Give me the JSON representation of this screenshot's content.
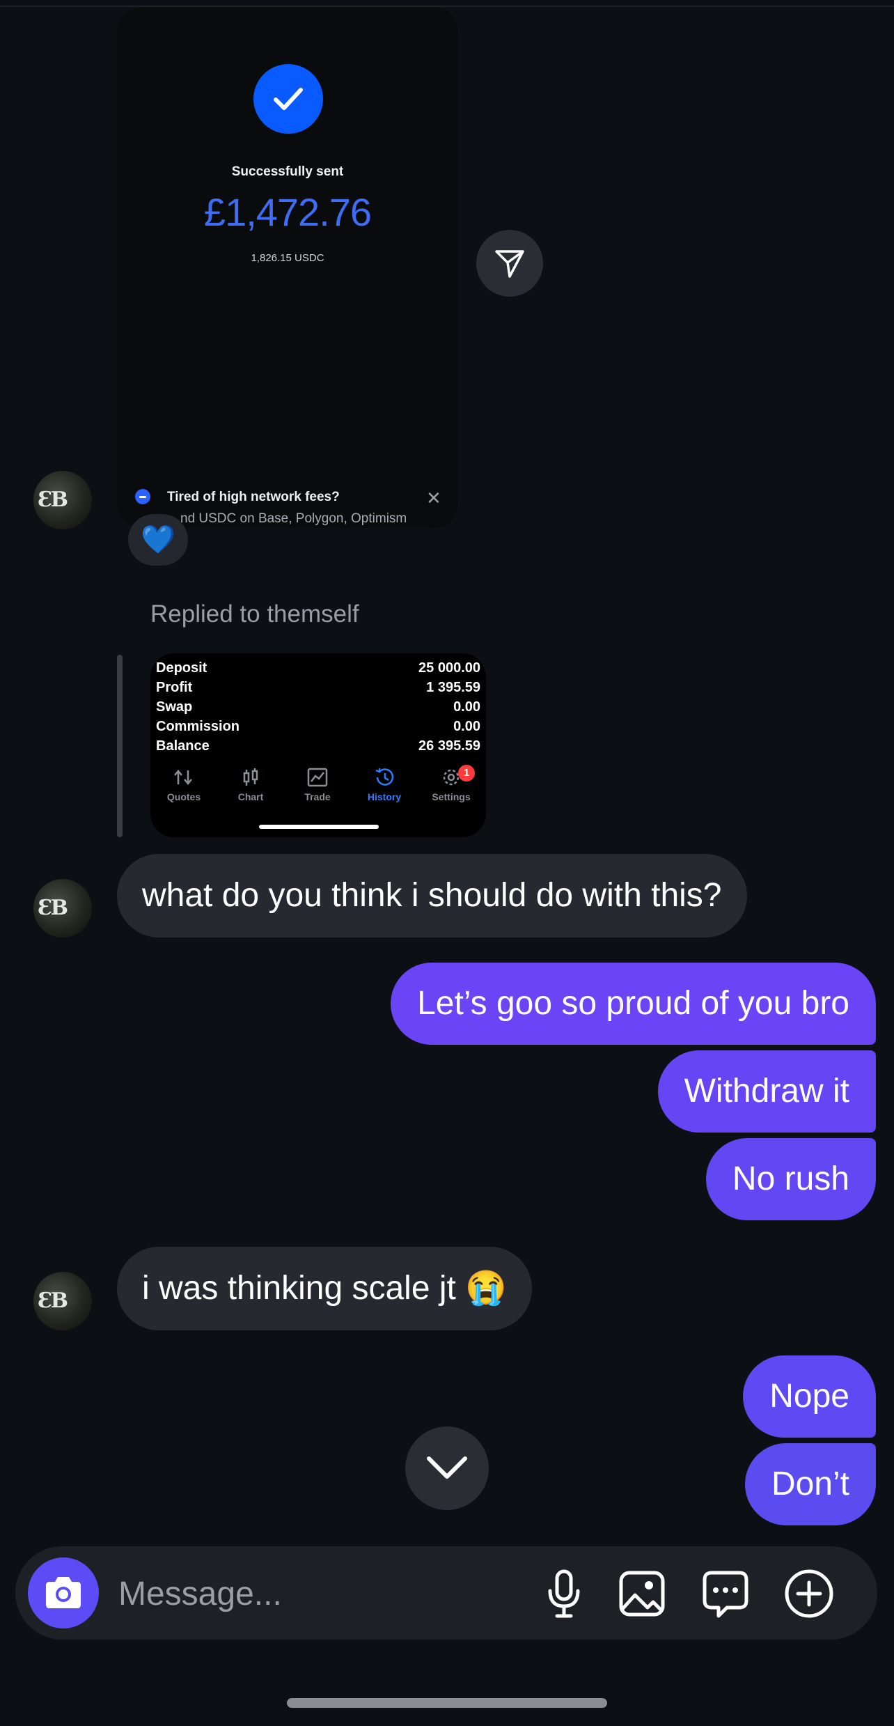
{
  "shared_payment": {
    "status": "Successfully sent",
    "amount": "£1,472.76",
    "sub_amount": "1,826.15 USDC",
    "banner_title": "Tired of high network fees?",
    "banner_subtitle": "…nd USDC on Base, Polygon, Optimism",
    "banner_close": "✕"
  },
  "reaction": "💙",
  "reply": {
    "label": "Replied to themself",
    "rows": [
      {
        "label": "Deposit",
        "value": "25 000.00"
      },
      {
        "label": "Profit",
        "value": "1 395.59"
      },
      {
        "label": "Swap",
        "value": "0.00"
      },
      {
        "label": "Commission",
        "value": "0.00"
      },
      {
        "label": "Balance",
        "value": "26 395.59"
      }
    ],
    "nav": [
      {
        "label": "Quotes",
        "icon": "quotes-icon"
      },
      {
        "label": "Chart",
        "icon": "chart-icon"
      },
      {
        "label": "Trade",
        "icon": "trade-icon"
      },
      {
        "label": "History",
        "icon": "history-icon",
        "active": true
      },
      {
        "label": "Settings",
        "icon": "settings-icon"
      }
    ],
    "settings_badge": "1"
  },
  "messages": {
    "in_1": "what do you think i should do with this?",
    "out_1": "Let’s goo so proud of you bro",
    "out_2": "Withdraw it",
    "out_3": "No rush",
    "in_2": "i was thinking scale jt 😭",
    "out_4": "Nope",
    "out_5": "Don’t"
  },
  "composer": {
    "placeholder": "Message...",
    "icons": [
      "camera-icon",
      "microphone-icon",
      "gallery-icon",
      "sticker-icon",
      "plus-icon"
    ]
  },
  "colors": {
    "background": "#0c0f14",
    "incoming_bubble": "#26292f",
    "outgoing_bubble_top": "#6a44f5",
    "outgoing_bubble_bottom": "#5b4cf0",
    "accent_blue": "#3e6cf5"
  }
}
